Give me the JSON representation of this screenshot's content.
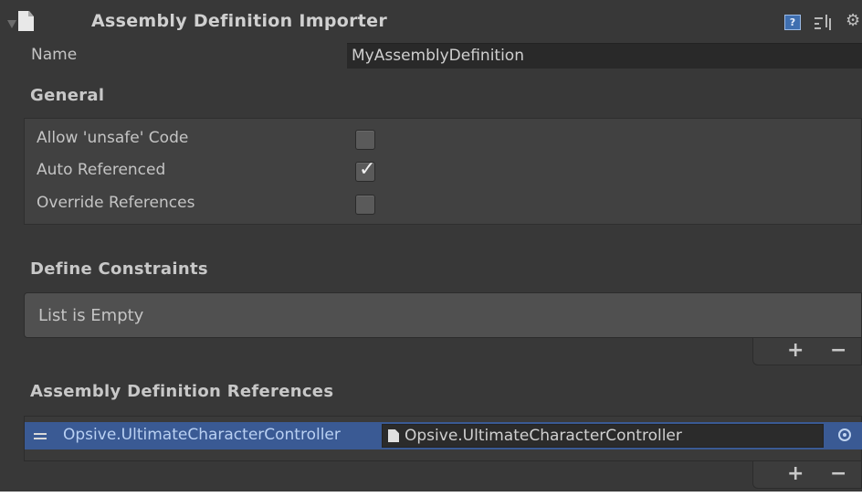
{
  "inspector": {
    "title": "Assembly Definition Importer",
    "icons": {
      "foldout": "foldout-expanded-icon",
      "asset": "asset-file-icon",
      "help": "help-icon",
      "presets": "presets-icon",
      "settings": "gear-icon"
    },
    "help_glyph": "?",
    "settings_glyph": "⚙"
  },
  "name_field": {
    "label": "Name",
    "value": "MyAssemblyDefinition"
  },
  "general": {
    "heading": "General",
    "options": [
      {
        "label": "Allow 'unsafe' Code",
        "checked": false
      },
      {
        "label": "Auto Referenced",
        "checked": true
      },
      {
        "label": "Override References",
        "checked": false
      }
    ],
    "check_glyph": "✓"
  },
  "define_constraints": {
    "heading": "Define Constraints",
    "empty_text": "List is Empty",
    "add_label": "+",
    "remove_label": "−"
  },
  "assembly_references": {
    "heading": "Assembly Definition References",
    "items": [
      {
        "name": "Opsive.UltimateCharacterController",
        "asset": "Opsive.UltimateCharacterController"
      }
    ],
    "add_label": "+",
    "remove_label": "−"
  },
  "colors": {
    "panel_bg": "#383838",
    "selected_row": "#3a5a94",
    "field_bg": "#292929"
  }
}
